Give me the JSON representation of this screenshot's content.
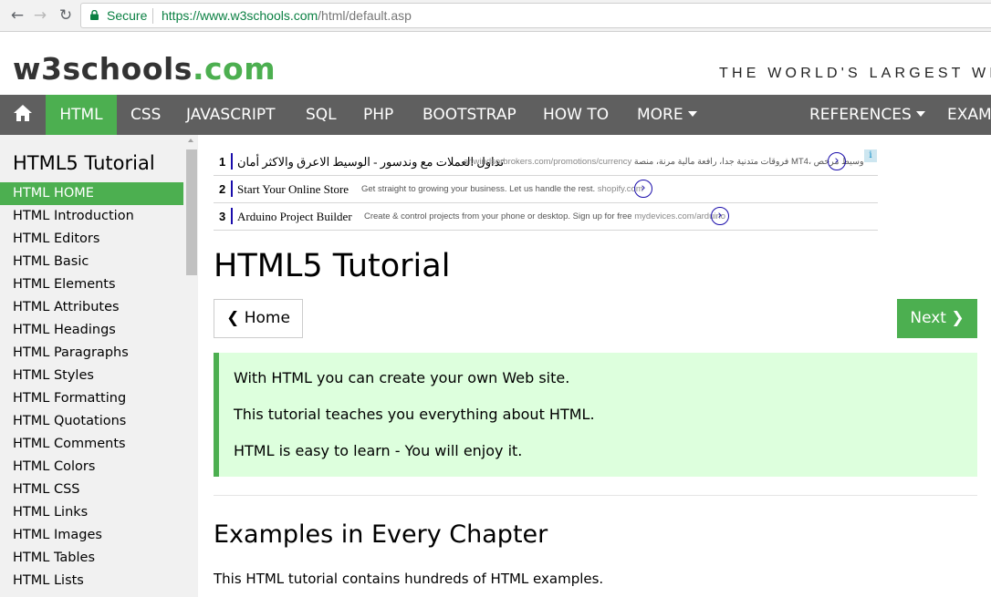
{
  "browser": {
    "secure_label": "Secure",
    "url_scheme_host": "https://www.w3schools.com",
    "url_path": "/html/default.asp"
  },
  "header": {
    "logo_main": "w3schools",
    "logo_tld": ".com",
    "tagline": "THE WORLD'S LARGEST WEB D"
  },
  "topnav": {
    "items": [
      "HTML",
      "CSS",
      "JAVASCRIPT",
      "SQL",
      "PHP",
      "BOOTSTRAP",
      "HOW TO",
      "MORE",
      "REFERENCES",
      "EXAM"
    ],
    "active": "HTML"
  },
  "sidebar": {
    "title": "HTML5 Tutorial",
    "items": [
      "HTML HOME",
      "HTML Introduction",
      "HTML Editors",
      "HTML Basic",
      "HTML Elements",
      "HTML Attributes",
      "HTML Headings",
      "HTML Paragraphs",
      "HTML Styles",
      "HTML Formatting",
      "HTML Quotations",
      "HTML Comments",
      "HTML Colors",
      "HTML CSS",
      "HTML Links",
      "HTML Images",
      "HTML Tables",
      "HTML Lists"
    ],
    "active": "HTML HOME"
  },
  "ads": [
    {
      "num": "1",
      "title": "تداول العملات مع وندسور - الوسيط الاعرق والاكثر أمان",
      "desc": "فروقات متدنية جدا، رافعة مالية مرنة، منصة MT4، وسيط مرخص",
      "url": "ar.windsorbrokers.com/promotions/currency"
    },
    {
      "num": "2",
      "title": "Start Your Online Store",
      "desc": "Get straight to growing your business. Let us handle the rest.",
      "url": "shopify.com"
    },
    {
      "num": "3",
      "title": "Arduino Project Builder",
      "desc": "Create & control projects from your phone or desktop. Sign up for free",
      "url": "mydevices.com/arduino"
    }
  ],
  "main": {
    "title": "HTML5 Tutorial",
    "home_button": "❮ Home",
    "next_button": "Next ❯",
    "note_lines": [
      "With HTML you can create your own Web site.",
      "This tutorial teaches you everything about HTML.",
      "HTML is easy to learn - You will enjoy it."
    ],
    "section_heading": "Examples in Every Chapter",
    "section_text": "This HTML tutorial contains hundreds of HTML examples."
  },
  "colors": {
    "accent_green": "#4caf50",
    "nav_gray": "#5f5f5f",
    "note_bg": "#ddffdd",
    "sidebar_bg": "#f1f1f1"
  }
}
